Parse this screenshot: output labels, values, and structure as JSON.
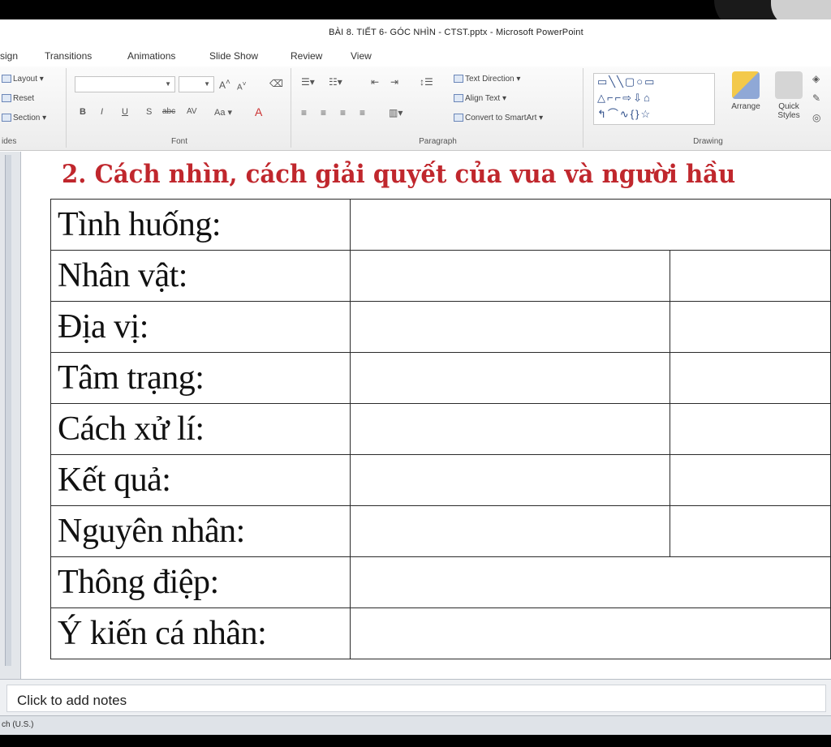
{
  "window": {
    "title": "BÀI 8. TIẾT 6- GÓC NHÌN - CTST.pptx - Microsoft PowerPoint"
  },
  "ribbon_tabs": [
    "sign",
    "Transitions",
    "Animations",
    "Slide Show",
    "Review",
    "View"
  ],
  "ribbon": {
    "slides_group": {
      "layout": "Layout",
      "reset": "Reset",
      "section": "Section",
      "label": "ides"
    },
    "font_group": {
      "label": "Font",
      "change_case": "Aa",
      "grow": "A",
      "shrink": "A"
    },
    "paragraph_group": {
      "text_direction": "Text Direction",
      "align_text": "Align Text",
      "convert_smartart": "Convert to SmartArt",
      "label": "Paragraph"
    },
    "drawing_group": {
      "arrange": "Arrange",
      "quick_styles": "Quick Styles",
      "label": "Drawing"
    }
  },
  "slide": {
    "title": "2. Cách nhìn, cách giải quyết của vua và người hầu",
    "rows": [
      "Tình huống:",
      "Nhân vật:",
      "Địa vị:",
      "Tâm trạng:",
      "Cách xử lí:",
      "Kết quả:",
      "Nguyên nhân:",
      "Thông điệp:",
      "Ý kiến cá nhân:"
    ]
  },
  "notes": {
    "placeholder": "Click to add notes"
  },
  "status": {
    "text": "ch (U.S.)"
  },
  "colors": {
    "title_red": "#c0272d",
    "ribbon_bg": "#f2f2f2"
  }
}
